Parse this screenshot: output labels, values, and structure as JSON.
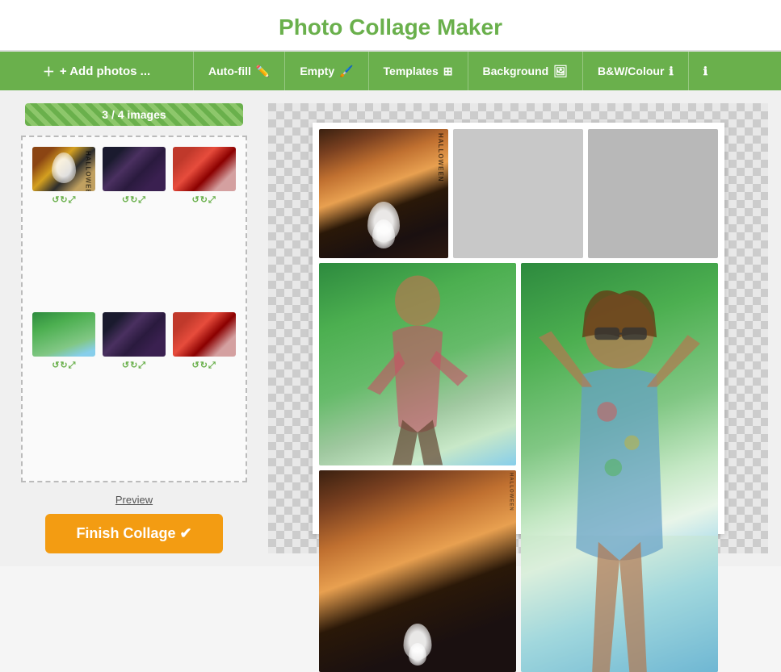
{
  "header": {
    "title": "Photo Collage Maker"
  },
  "toolbar": {
    "add_photos": "+ Add photos ...",
    "autofill": "Auto-fill",
    "empty": "Empty",
    "templates": "Templates",
    "background": "Background",
    "bw_colour": "B&W/Colour",
    "info": "ℹ"
  },
  "left_panel": {
    "images_badge": "3 / 4 images",
    "preview_link": "Preview",
    "finish_button": "Finish Collage ✔"
  },
  "thumbnails": [
    {
      "id": 1,
      "class": "photo1",
      "controls": "↺↻⤢"
    },
    {
      "id": 2,
      "class": "photo2",
      "controls": "↺↻⤢"
    },
    {
      "id": 3,
      "class": "photo3",
      "controls": "↺↻⤢"
    },
    {
      "id": 4,
      "class": "photo4",
      "controls": "↺↻⤢"
    },
    {
      "id": 5,
      "class": "photo5",
      "controls": "↺↻⤢"
    },
    {
      "id": 6,
      "class": "photo6",
      "controls": "↺↻⤢"
    }
  ],
  "collage": {
    "layout": "3-col-top, 2-col-middle-bottom",
    "cells": [
      {
        "id": 1,
        "type": "photo",
        "photo": "halloween"
      },
      {
        "id": 2,
        "type": "empty"
      },
      {
        "id": 3,
        "type": "empty"
      },
      {
        "id": 4,
        "type": "photo",
        "photo": "green-field-girl"
      },
      {
        "id": 5,
        "type": "photo",
        "photo": "halloween-small"
      },
      {
        "id": 6,
        "type": "photo",
        "photo": "outdoor-large"
      }
    ]
  }
}
